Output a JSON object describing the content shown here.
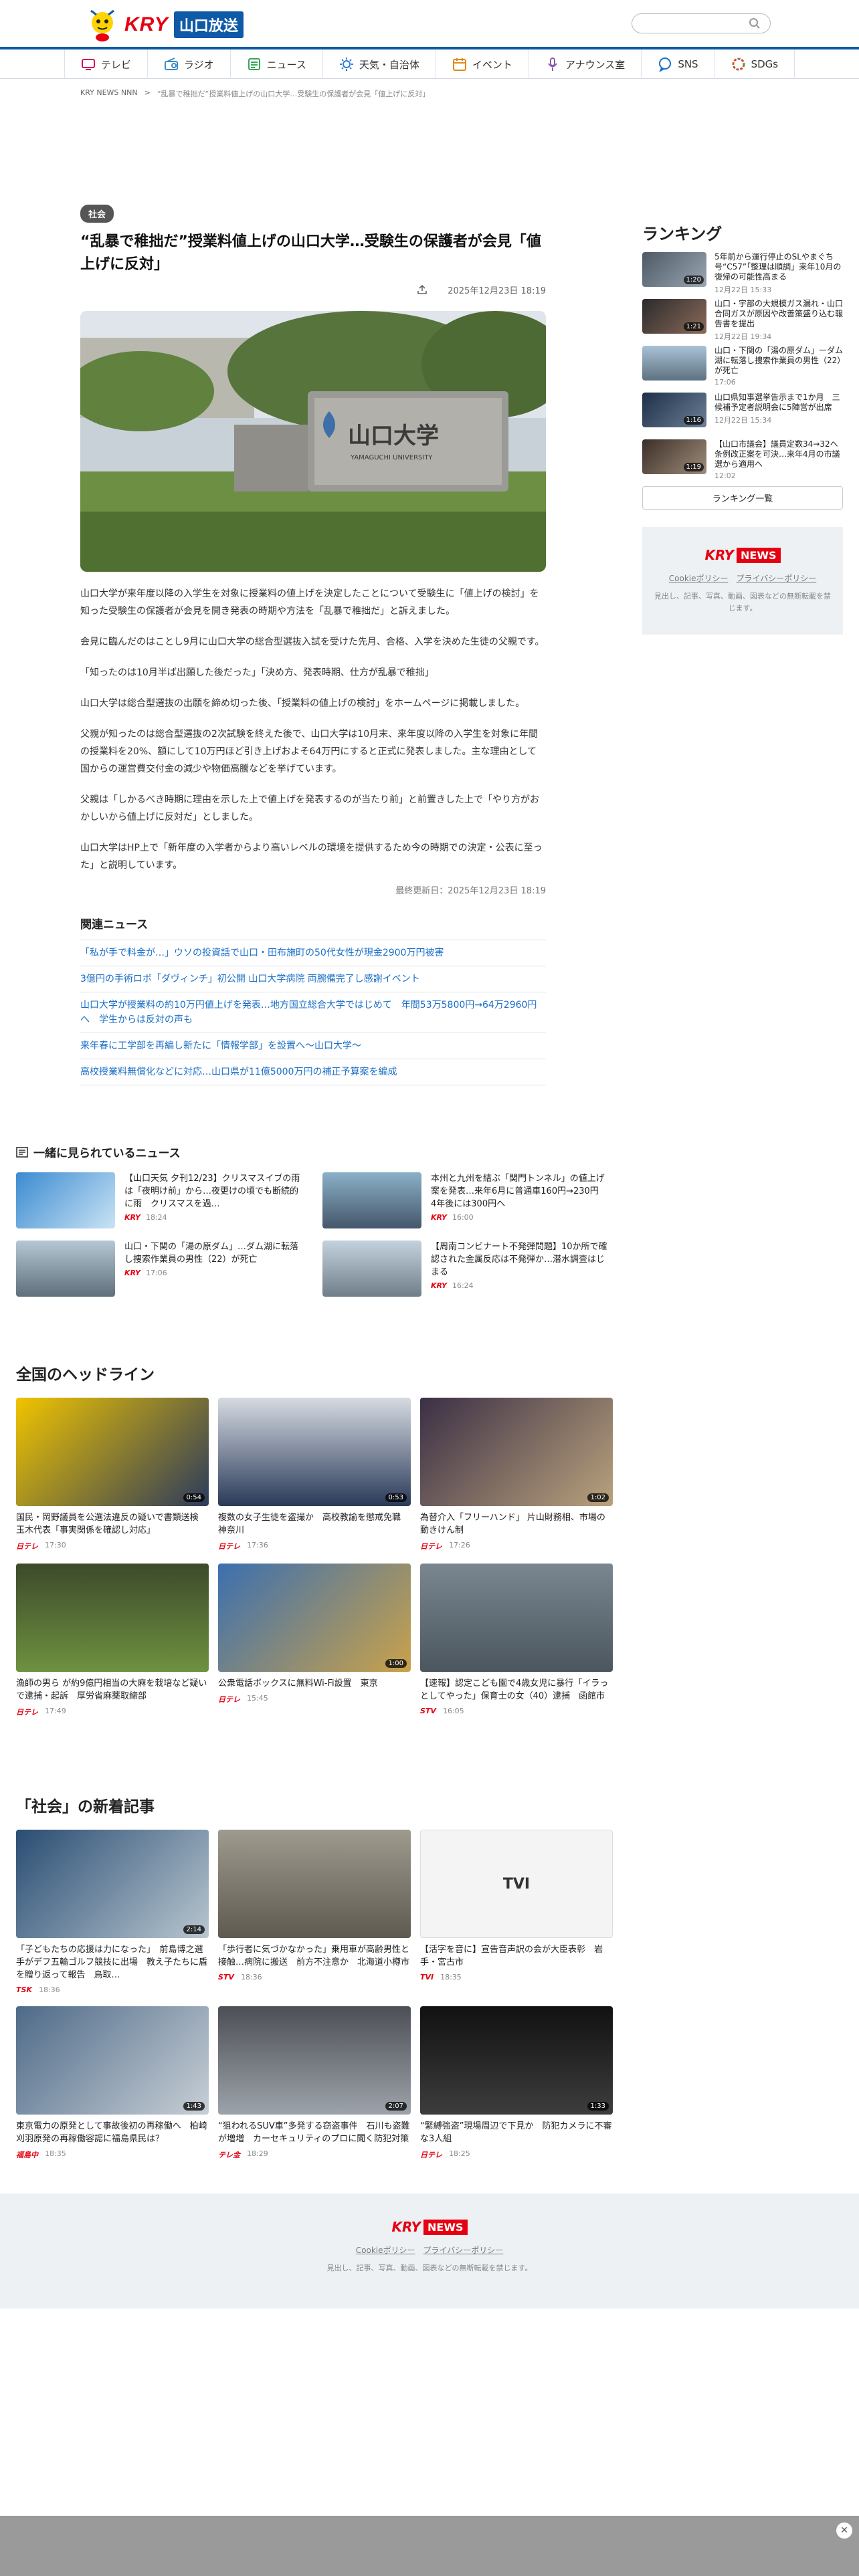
{
  "header": {
    "logo_brand": "KRY",
    "logo_station": "山口放送",
    "search_placeholder": ""
  },
  "nav": [
    {
      "label": "テレビ",
      "icon": "tv-icon",
      "color": "#d0135e"
    },
    {
      "label": "ラジオ",
      "icon": "radio-icon",
      "color": "#3a8cc9"
    },
    {
      "label": "ニュース",
      "icon": "news-icon",
      "color": "#3aa65c"
    },
    {
      "label": "天気・自治体",
      "icon": "sun-icon",
      "color": "#2d7ad6"
    },
    {
      "label": "イベント",
      "icon": "calendar-icon",
      "color": "#e08a18"
    },
    {
      "label": "アナウンス室",
      "icon": "microphone-icon",
      "color": "#8e58b5"
    },
    {
      "label": "SNS",
      "icon": "chat-icon",
      "color": "#1a6ec7"
    },
    {
      "label": "SDGs",
      "icon": "sdgs-icon",
      "color": "#e0472b"
    }
  ],
  "breadcrumb": {
    "home": "KRY NEWS NNN",
    "current": "“乱暴で稚拙だ”授業料値上げの山口大学…受験生の保護者が会見「値上げに反対」"
  },
  "article": {
    "category": "社会",
    "title": "“乱暴で稚拙だ”授業料値上げの山口大学…受験生の保護者が会見「値上げに反対」",
    "date": "2025年12月23日 18:19",
    "photo_sign_main": "山口大学",
    "photo_sign_sub": "YAMAGUCHI UNIVERSITY",
    "paragraphs": [
      "山口大学が来年度以降の入学生を対象に授業料の値上げを決定したことについて受験生に「値上げの検討」を知った受験生の保護者が会見を開き発表の時期や方法を「乱暴で稚拙だ」と訴えました。",
      "会見に臨んだのはことし9月に山口大学の総合型選抜入試を受けた先月、合格、入学を決めた生徒の父親です。",
      "「知ったのは10月半ば出願した後だった」「決め方、発表時期、仕方が乱暴で稚拙」",
      "山口大学は総合型選抜の出願を締め切った後、「授業料の値上げの検討」をホームページに掲載しました。",
      "父親が知ったのは総合型選抜の2次試験を終えた後で、山口大学は10月末、来年度以降の入学生を対象に年間の授業料を20%、額にして10万円ほど引き上げおよそ64万円にすると正式に発表しました。主な理由として国からの運営費交付金の減少や物価高騰などを挙げています。",
      "父親は「しかるべき時期に理由を示した上で値上げを発表するのが当たり前」と前置きした上で「やり方がおかしいから値上げに反対だ」としました。",
      "山口大学はHP上で「新年度の入学者からより高いレベルの環境を提供するため今の時期での決定・公表に至った」と説明しています。"
    ],
    "updated": "最終更新日：2025年12月23日 18:19"
  },
  "related": {
    "heading": "関連ニュース",
    "items": [
      "「私が手で料金が…」ウソの投資話で山口・田布施町の50代女性が現金2900万円被害",
      "3億円の手術ロボ「ダヴィンチ」初公開 山口大学病院 両腕備完了し感謝イベント",
      "山口大学が授業料の約10万円値上げを発表…地方国立総合大学ではじめて　年間53万5800円→64万2960円へ　学生からは反対の声も",
      "来年春に工学部を再編し新たに「情報学部」を設置へ〜山口大学〜",
      "高校授業料無償化などに対応…山口県が11億5000万円の補正予算案を編成"
    ]
  },
  "ranking": {
    "heading": "ランキング",
    "items": [
      {
        "text": "5年前から運行停止のSLやまぐち号“C57”「整理は順調」来年10月の復帰の可能性高まる",
        "time": "12月22日 15:33",
        "badge": "1:20"
      },
      {
        "text": "山口・宇部の大規模ガス漏れ・山口合同ガスが原因や改善策盛り込む報告書を提出",
        "time": "12月22日 19:34",
        "badge": "1:21"
      },
      {
        "text": "山口・下関の「湯の原ダム」ーダム湖に転落し捜索作業員の男性（22）が死亡",
        "time": "17:06",
        "badge": ""
      },
      {
        "text": "山口県知事選挙告示まで1か月　三候補予定者説明会に5陣営が出席",
        "time": "12月22日 15:34",
        "badge": "1:16"
      },
      {
        "text": "【山口市議会】議員定数34→32へ条例改正案を可決…来年4月の市議選から適用へ",
        "time": "12:02",
        "badge": "1:19"
      }
    ],
    "more": "ランキング一覧"
  },
  "sidebox": {
    "brand": "KRY",
    "news": "NEWS",
    "links": [
      "Cookieポリシー",
      "プライバシーポリシー"
    ],
    "note": "見出し、記事、写真、動画、図表などの無断転載を禁じます。"
  },
  "popular": {
    "heading": "一緒に見られているニュース",
    "items": [
      {
        "text": "【山口天気 夕刊12/23】クリスマスイブの雨は「夜明け前」から…夜更けの頃でも断続的に雨　クリスマスを過…",
        "src": "KRY",
        "time": "18:24"
      },
      {
        "text": "本州と九州を結ぶ「関門トンネル」の値上げ案を発表…来年6月に普通車160円→230円　4年後には300円へ",
        "src": "KRY",
        "time": "16:00"
      },
      {
        "text": "山口・下関の「湯の原ダム」…ダム湖に転落し捜索作業員の男性（22）が死亡",
        "src": "KRY",
        "time": "17:06"
      },
      {
        "text": "【周南コンビナート不発弾問題】10か所で確認された金属反応は不発弾か…潜水調査はじまる",
        "src": "KRY",
        "time": "16:24"
      }
    ]
  },
  "national": {
    "heading": "全国のヘッドライン",
    "items": [
      {
        "text": "国民・岡野議員を公選法違反の疑いで書類送検　玉木代表「事実関係を確認し対応」",
        "src": "日テレ",
        "time": "17:30",
        "dur": "0:54"
      },
      {
        "text": "複数の女子生徒を盗撮か　高校教諭を懲戒免職　神奈川",
        "src": "日テレ",
        "time": "17:36",
        "dur": "0:53"
      },
      {
        "text": "為替介入「フリーハンド」 片山財務相、市場の動きけん制",
        "src": "日テレ",
        "time": "17:26",
        "dur": "1:02"
      },
      {
        "text": "漁師の男ら が約9億円相当の大麻を栽培など疑いで逮捕・起訴　厚労省麻薬取締部",
        "src": "日テレ",
        "time": "17:49",
        "dur": ""
      },
      {
        "text": "公衆電話ボックスに無料Wi-Fi設置　東京",
        "src": "日テレ",
        "time": "15:45",
        "dur": "1:00"
      },
      {
        "text": "【速報】認定こども園で4歳女児に暴行「イラっとしてやった」保育士の女（40）逮捕　函館市",
        "src": "STV",
        "time": "16:05",
        "dur": ""
      }
    ]
  },
  "social": {
    "heading": "「社会」の新着記事",
    "items": [
      {
        "text": "「子どもたちの応援は力になった」　前島博之選手がデフ五輪ゴルフ競技に出場　教え子たちに盾を贈り返って報告　鳥取…",
        "src": "TSK",
        "time": "18:36",
        "dur": "2:14"
      },
      {
        "text": "「歩行者に気づかなかった」乗用車が高齢男性と接触…病院に搬送　前方不注意か　北海道小樽市",
        "src": "STV",
        "time": "18:36",
        "dur": ""
      },
      {
        "text": "【活字を音に】宣告音声訳の会が大臣表彰　岩手・宮古市",
        "src": "TVI",
        "time": "18:35",
        "dur": ""
      },
      {
        "text": "東京電力の原発として事故後初の再稼働へ　柏崎刈羽原発の再稼働容認に福島県民は？",
        "src": "福島中",
        "time": "18:35",
        "dur": "1:43"
      },
      {
        "text": "“狙われるSUV車”多発する窃盗事件　石川も盗難が増増　カーセキュリティのプロに聞く防犯対策",
        "src": "テレ金",
        "time": "18:29",
        "dur": "2:07"
      },
      {
        "text": "“緊縛強盗”現場周辺で下見か　防犯カメラに不審な3人組",
        "src": "日テレ",
        "time": "18:25",
        "dur": "1:33"
      }
    ]
  },
  "footer": {
    "brand": "KRY",
    "news": "NEWS",
    "links": [
      "Cookieポリシー",
      "プライバシーポリシー"
    ],
    "note": "見出し、記事、写真、動画、図表などの無断転載を禁じます。"
  }
}
